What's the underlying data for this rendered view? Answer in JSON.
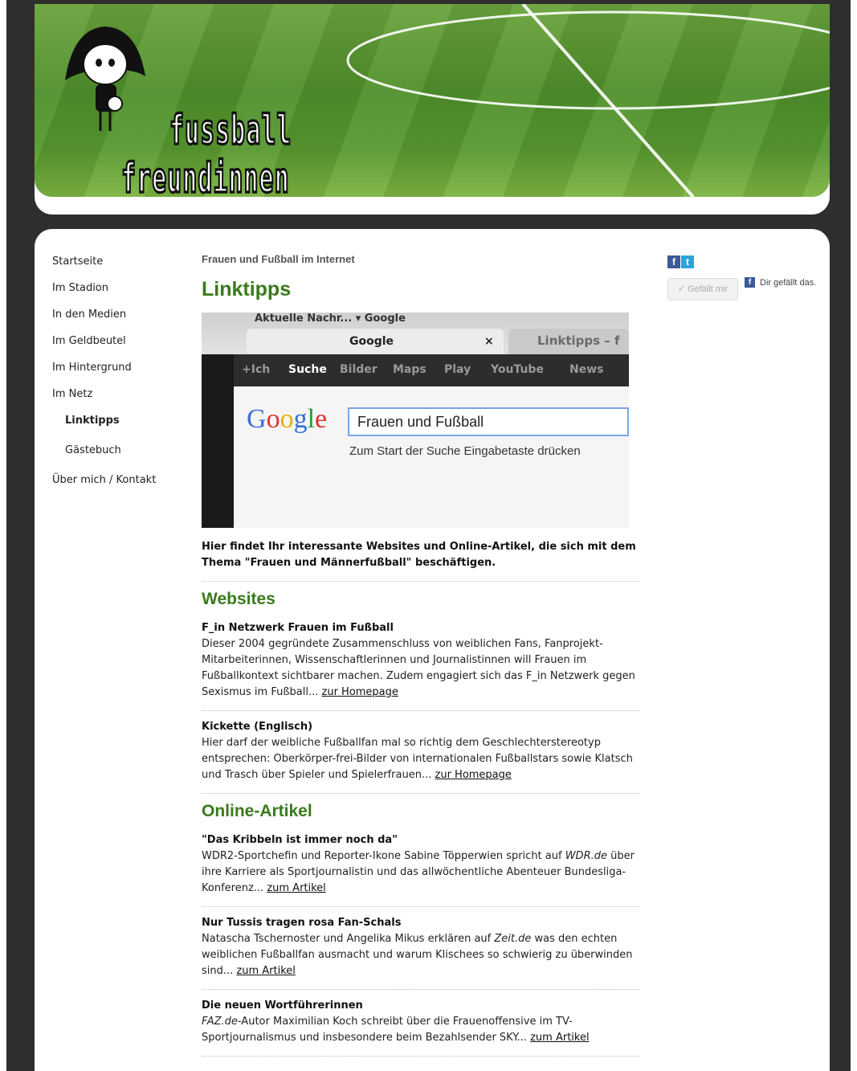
{
  "logo": {
    "line1": "fussball",
    "line2": "freundinnen"
  },
  "nav": [
    {
      "label": "Startseite"
    },
    {
      "label": "Im Stadion"
    },
    {
      "label": "In den Medien"
    },
    {
      "label": "Im Geldbeutel"
    },
    {
      "label": "Im Hintergrund"
    },
    {
      "label": "Im Netz"
    },
    {
      "label": "Linktipps"
    },
    {
      "label": "Gästebuch"
    },
    {
      "label": "Über mich / Kontakt"
    }
  ],
  "breadcrumb": "Frauen und Fußball im Internet",
  "title": "Linktipps",
  "photo": {
    "bookmarks": "Aktuelle Nachr... ▾  Google",
    "tab1": "Google",
    "tab1_close": "×",
    "tab2": "Linktipps – f",
    "gbar": [
      "+Ich",
      "Suche",
      "Bilder",
      "Maps",
      "Play",
      "YouTube",
      "News"
    ],
    "search_value": "Frauen und Fußball",
    "hint": "Zum Start der Suche Eingabetaste drücken"
  },
  "intro": "Hier findet Ihr interessante Websites und Online-Artikel, die sich mit dem Thema \"Frauen und Männerfußball\" beschäftigen.",
  "websites": {
    "heading": "Websites",
    "items": [
      {
        "title": "F_in Netzwerk Frauen im Fußball",
        "text": "Dieser 2004 gegründete Zusammenschluss von weiblichen Fans, Fanprojekt-Mitarbeiterinnen, Wissenschaftlerinnen und Journalistinnen will Frauen im Fußballkontext sichtbarer machen. Zudem engagiert sich das F_in Netzwerk gegen Sexismus im Fußball...",
        "link": "zur Homepage"
      },
      {
        "title": "Kickette (Englisch)",
        "text": "Hier darf der weibliche Fußballfan mal so richtig dem Geschlechterstereotyp entsprechen: Oberkörper-frei-Bilder von internationalen Fußballstars sowie Klatsch und Trasch über Spieler und Spielerfrauen...",
        "link": "zur Homepage"
      }
    ]
  },
  "articles": {
    "heading": "Online-Artikel",
    "items": [
      {
        "title": "\"Das Kribbeln ist immer noch da\"",
        "pre": "WDR2-Sportchefin und Reporter-Ikone Sabine Töpperwien spricht auf ",
        "source": "WDR.de",
        "post": " über ihre Karriere als Sportjournalistin und das allwöchentliche Abenteuer Bundesliga-Konferenz...",
        "link": "zum Artikel"
      },
      {
        "title": "Nur Tussis tragen rosa Fan-Schals",
        "pre": "Natascha Tschernoster und Angelika Mikus erklären auf ",
        "source": "Zeit.de",
        "post": " was den echten weiblichen Fußballfan ausmacht und warum Klischees so schwierig zu überwinden sind...",
        "link": "zum Artikel"
      },
      {
        "title": "Die neuen Wortführerinnen",
        "pre": "",
        "source": "FAZ.de",
        "post": "-Autor Maximilian Koch schreibt über die Frauenoffensive im TV-Sportjournalismus und insbesondere beim Bezahlsender SKY...",
        "link": "zum Artikel"
      }
    ]
  },
  "social": {
    "fb_glyph": "f",
    "tw_glyph": "t",
    "like_label": "✓ Gefällt mir",
    "like_info": "Dir gefällt das."
  },
  "colors": {
    "accent": "#3a7a1c",
    "background": "#2e2e2e"
  }
}
